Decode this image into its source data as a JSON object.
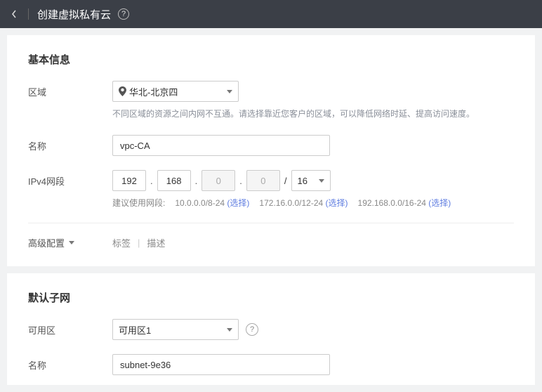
{
  "header": {
    "title": "创建虚拟私有云"
  },
  "basic": {
    "section_title": "基本信息",
    "region_label": "区域",
    "region_value": "华北-北京四",
    "region_hint": "不同区域的资源之间内网不互通。请选择靠近您客户的区域，可以降低网络时延、提高访问速度。",
    "name_label": "名称",
    "name_value": "vpc-CA",
    "ipv4_label": "IPv4网段",
    "ipv4": {
      "o1": "192",
      "o2": "168",
      "o3": "0",
      "o4": "0",
      "slash": "/",
      "cidr": "16"
    },
    "suggest_label": "建议使用网段:",
    "suggest1": "10.0.0.0/8-24",
    "suggest2": "172.16.0.0/12-24",
    "suggest3": "192.168.0.0/16-24",
    "choose": "(选择)",
    "advanced_label": "高级配置",
    "tag_label": "标签",
    "desc_label": "描述"
  },
  "subnet": {
    "section_title": "默认子网",
    "az_label": "可用区",
    "az_value": "可用区1",
    "name_label": "名称",
    "name_value": "subnet-9e36"
  }
}
